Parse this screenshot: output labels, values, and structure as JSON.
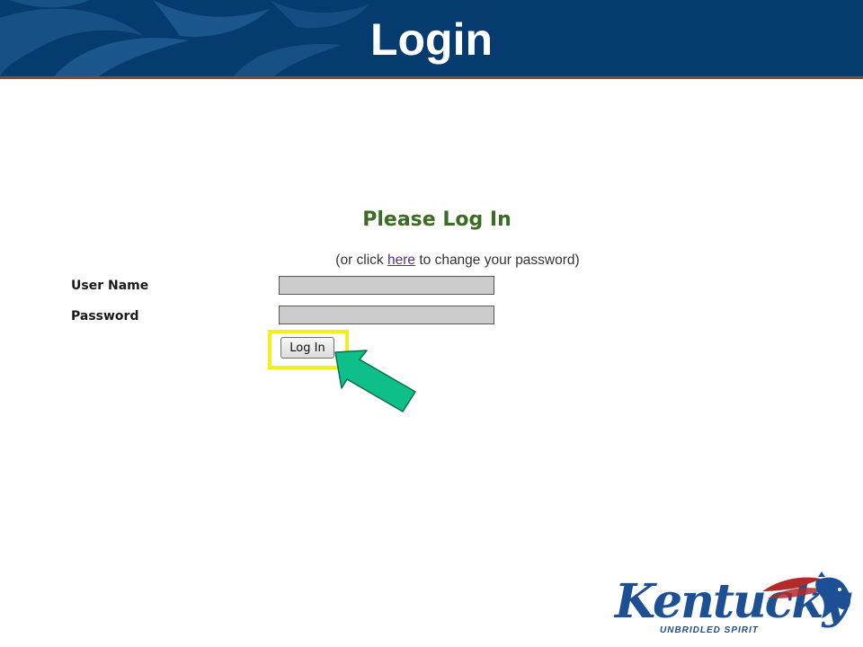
{
  "header": {
    "title": "Login",
    "colors": {
      "banner": "#053b6e",
      "rule": "#8a4a2a"
    }
  },
  "form": {
    "heading": "Please Log In",
    "subtitle_before": "(or click ",
    "subtitle_link": "here",
    "subtitle_after": " to change your password)",
    "username_label": "User Name",
    "username_value": "",
    "password_label": "Password",
    "password_value": "",
    "login_button": "Log In"
  },
  "annotations": {
    "highlight_color": "#f4ef1c",
    "arrow_color": "#0fbf8a",
    "arrow_icon": "arrow-pointer-icon"
  },
  "logo": {
    "word": "Kentucky",
    "tagline": "UNBRIDLED SPIRIT",
    "icon": "horse-head-icon"
  }
}
